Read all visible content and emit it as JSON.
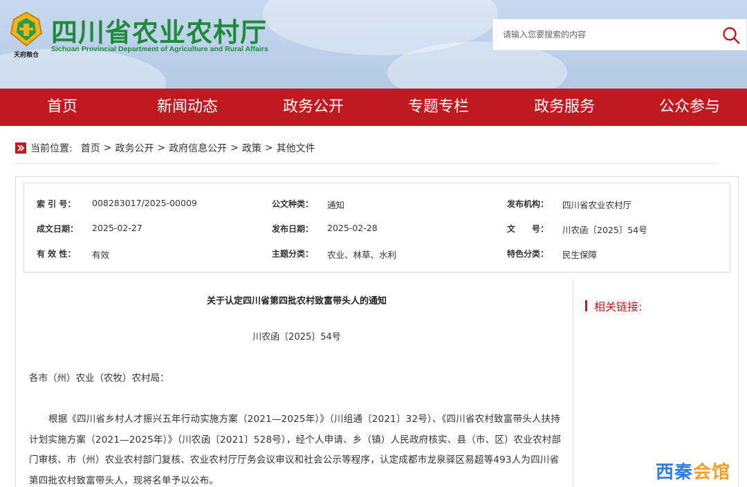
{
  "header": {
    "site_title": "四川省农业农村厅",
    "site_subtitle": "Sichuan Provincial Department of Agriculture and Rural Affairs",
    "logo_caption": "天府粮仓",
    "search_placeholder": "请输入您要搜索的内容"
  },
  "nav": {
    "items": [
      {
        "label": "首页"
      },
      {
        "label": "新闻动态"
      },
      {
        "label": "政务公开"
      },
      {
        "label": "专题专栏"
      },
      {
        "label": "政务服务"
      },
      {
        "label": "公众参与"
      }
    ]
  },
  "breadcrumb": {
    "prefix": "当前位置:",
    "items": [
      "首页",
      "政务公开",
      "政府信息公开",
      "政策",
      "其他文件"
    ],
    "separator": ">"
  },
  "info": {
    "index_label": "索 引 号：",
    "index_value": "008283017/2025-00009",
    "doctype_label": "公文种类：",
    "doctype_value": "通知",
    "issuer_label": "发布机构：",
    "issuer_value": "四川省农业农村厅",
    "created_label": "成文日期：",
    "created_value": "2025-02-27",
    "published_label": "发布日期：",
    "published_value": "2025-02-28",
    "docno_label": "文　　号：",
    "docno_value": "川农函〔2025〕54号",
    "validity_label": "有 效 性：",
    "validity_value": "有效",
    "topic_label": "主题分类：",
    "topic_value": "农业、林草、水利",
    "feature_label": "特色分类：",
    "feature_value": "民生保障"
  },
  "article": {
    "title": "关于认定四川省第四批农村致富带头人的通知",
    "doc_number": "川农函〔2025〕54号",
    "salutation": "各市（州）农业（农牧）农村局：",
    "paragraph": "根据《四川省乡村人才振兴五年行动实施方案（2021—2025年）》（川组通〔2021〕32号）、《四川省农村致富带头人扶持计划实施方案（2021—2025年）》（川农函〔2021〕528号），经个人申请、乡（镇）人民政府核实、县（市、区）农业农村部门审核、市（州）农业农村部门复核、农业农村厅厅务会议审议和社会公示等程序，认定成都市龙泉驿区易超等493人为四川省第四批农村致富带头人，现将名单予以公布。"
  },
  "sidebar": {
    "related_title": "相关链接:"
  },
  "watermark": {
    "part1": "西秦",
    "part2": "会馆"
  },
  "colors": {
    "nav_red": "#c01920",
    "title_green": "#1f8a3a",
    "header_blue": "#bcd0ea"
  }
}
